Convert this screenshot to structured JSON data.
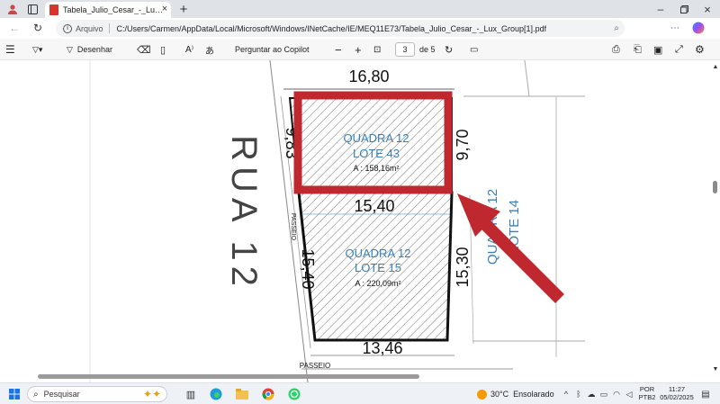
{
  "browser": {
    "tab_title": "Tabela_Julio_Cesar_-_Lux_Group[1]...",
    "address_prefix": "Arquivo",
    "url": "C:/Users/Carmen/AppData/Local/Microsoft/Windows/INetCache/IE/MEQ11E73/Tabela_Julio_Cesar_-_Lux_Group[1].pdf"
  },
  "pdf_toolbar": {
    "draw_label": "Desenhar",
    "copilot_label": "Perguntar ao Copilot",
    "page_current": "3",
    "page_total": "de 5"
  },
  "drawing": {
    "street": "RUA 12",
    "lot43_block": "QUADRA 12",
    "lot43_lot": "LOTE 43",
    "lot43_area": "A : 158,16m²",
    "lot15_block": "QUADRA 12",
    "lot15_lot": "LOTE 15",
    "lot15_area": "A : 220,09m²",
    "lot14_block": "QUADRA 12",
    "lot14_lot": "LOTE 14",
    "dim_top": "16,80",
    "dim_left_upper": "9,83",
    "dim_right_upper": "9,70",
    "dim_middle": "15,40",
    "dim_left_lower": "15,40",
    "dim_right_lower": "15,30",
    "dim_bottom": "13,46",
    "passeio_side": "PASSEIO",
    "passeio_bottom": "PASSEIO",
    "highlight_color": "#c0282f"
  },
  "taskbar": {
    "search_label": "Pesquisar",
    "weather_temp": "30°C",
    "weather_text": "Ensolarado",
    "lang": "POR",
    "layout": "PTB2",
    "time": "11:27",
    "date": "05/02/2025"
  }
}
